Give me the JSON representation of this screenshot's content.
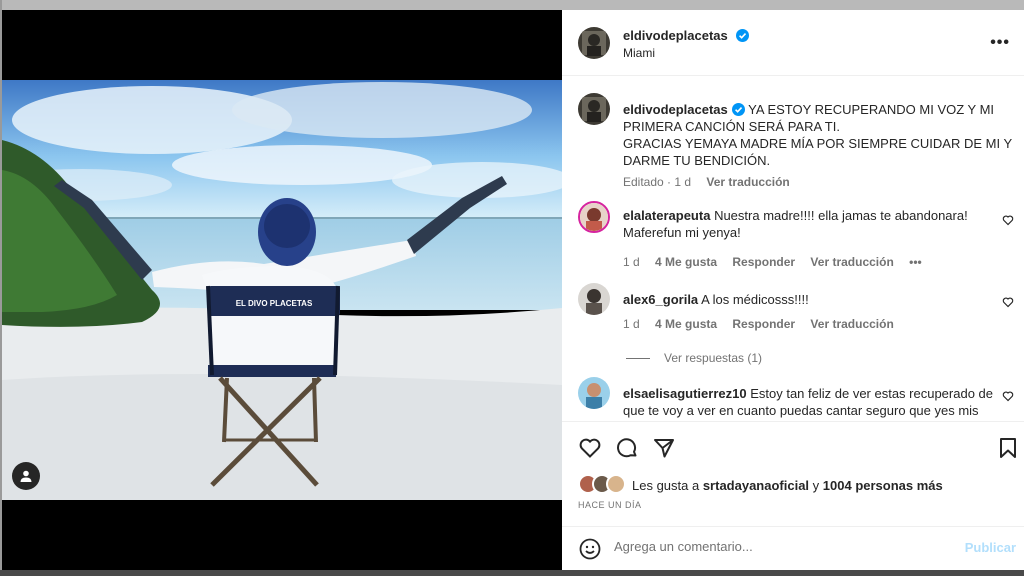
{
  "post": {
    "author": "eldivodeplacetas",
    "location": "Miami",
    "caption": "YA ESTOY RECUPERANDO MI VOZ Y MI PRIMERA CANCIÓN SERÁ PARA TI. GRACIAS YEMAYA MADRE MÍA POR SIEMPRE CUIDAR DE MI Y DARME TU BENDICIÓN.",
    "caption_line1": "YA ESTOY RECUPERANDO MI VOZ Y MI",
    "caption_line2": "PRIMERA CANCIÓN SERÁ PARA TI.",
    "caption_line3": "GRACIAS YEMAYA MADRE MÍA POR SIEMPRE CUIDAR DE MI Y",
    "caption_line4": "DARME TU BENDICIÓN.",
    "edited": "Editado · 1 d",
    "see_translation": "Ver traducción",
    "chair_text": "EL DIVO PLACETAS"
  },
  "comments": [
    {
      "user": "elalaterapeuta",
      "line1": "Nuestra madre!!!! ella jamas te abandonara!",
      "line2": "Maferefun mi yenya!",
      "age": "1 d",
      "likes": "4 Me gusta",
      "reply": "Responder",
      "translate": "Ver traducción"
    },
    {
      "user": "alex6_gorila",
      "line1": "A los médicosss!!!!",
      "age": "1 d",
      "likes": "4 Me gusta",
      "reply": "Responder",
      "translate": "Ver traducción",
      "view_replies": "Ver respuestas (1)"
    },
    {
      "user": "elsaelisagutierrez10",
      "line1": "Estoy tan feliz de ver estas recuperado de",
      "line2": "que te voy a ver en cuanto puedas cantar seguro que yes mis"
    }
  ],
  "likes": {
    "prefix": "Les gusta a ",
    "user": "srtadayanaoficial",
    "middle": " y ",
    "count": "1004 personas más"
  },
  "timestamp": "HACE UN DÍA",
  "add_comment": {
    "placeholder": "Agrega un comentario...",
    "publish": "Publicar"
  },
  "colors": {
    "verified": "#0095f6",
    "publish_disabled": "#b2dffc",
    "secondary_text": "#737373"
  },
  "icons": [
    "user-tag-icon",
    "more-options-icon",
    "verified-icon",
    "heart-icon",
    "comment-icon",
    "share-icon",
    "bookmark-icon",
    "emoji-icon"
  ]
}
